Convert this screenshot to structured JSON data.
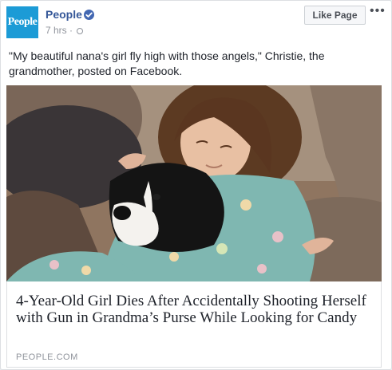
{
  "header": {
    "logo_text": "People",
    "page_name": "People",
    "timestamp": "7 hrs",
    "separator": "·",
    "like_button": "Like Page",
    "more_glyph": "•••"
  },
  "post": {
    "caption": "\"My beautiful nana's girl fly high with those angels,\" Christie, the grandmother, posted on Facebook."
  },
  "link": {
    "headline": "4-Year-Old Girl Dies After Accidentally Shooting Herself with Gun in Grandma’s Purse While Looking for Candy",
    "domain": "PEOPLE.COM"
  },
  "colors": {
    "brand": "#1c9bd6",
    "link_blue": "#365899",
    "verified": "#4267b2",
    "secondary_text": "#90949c"
  },
  "icons": [
    "verified-badge-icon",
    "globe-icon",
    "more-options-icon"
  ]
}
